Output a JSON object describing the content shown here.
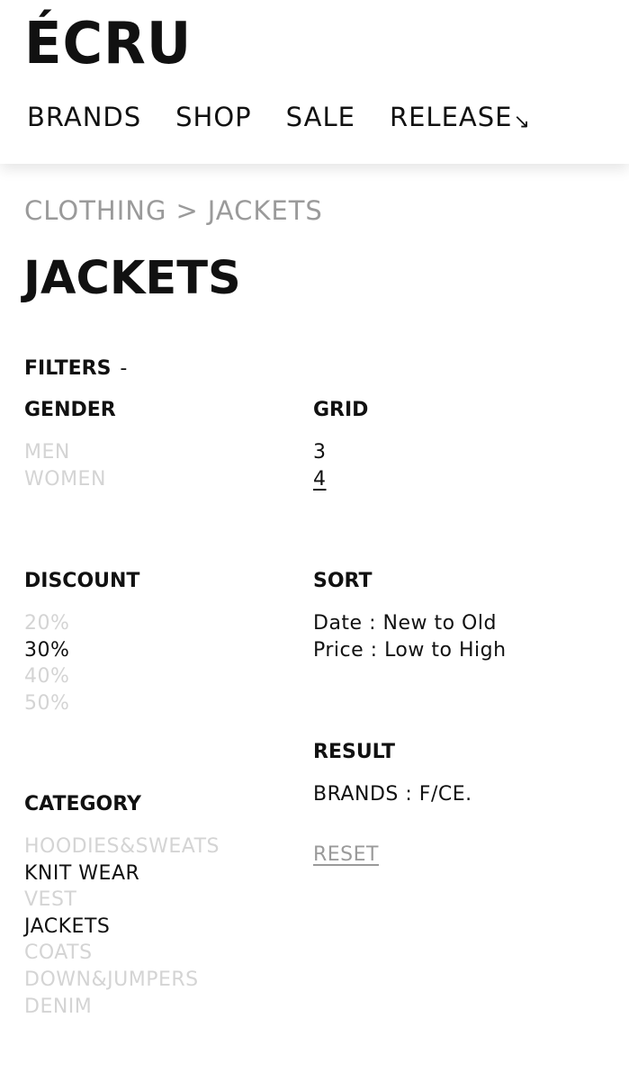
{
  "header": {
    "logo": "ÉCRU",
    "nav": [
      {
        "label": "BRANDS"
      },
      {
        "label": "SHOP"
      },
      {
        "label": "SALE"
      },
      {
        "label": "RELEASE",
        "icon": "↘"
      }
    ]
  },
  "breadcrumb": {
    "items": [
      "CLOTHING",
      "JACKETS"
    ],
    "separator": ">"
  },
  "page_title": "JACKETS",
  "filters": {
    "label": "FILTERS",
    "toggle": "-",
    "gender": {
      "heading": "GENDER",
      "options": [
        {
          "label": "MEN",
          "selected": false
        },
        {
          "label": "WOMEN",
          "selected": false
        }
      ]
    },
    "grid": {
      "heading": "GRID",
      "options": [
        {
          "label": "3",
          "selected": false
        },
        {
          "label": "4",
          "selected": true
        }
      ]
    },
    "discount": {
      "heading": "DISCOUNT",
      "options": [
        {
          "label": "20%",
          "selected": false
        },
        {
          "label": "30%",
          "selected": true
        },
        {
          "label": "40%",
          "selected": false
        },
        {
          "label": "50%",
          "selected": false
        }
      ]
    },
    "sort": {
      "heading": "SORT",
      "options": [
        {
          "label": "Date : New to Old"
        },
        {
          "label": "Price : Low to High"
        }
      ]
    },
    "result": {
      "heading": "RESULT",
      "text": "BRANDS : F/CE.",
      "reset": "RESET"
    },
    "category": {
      "heading": "CATEGORY",
      "options": [
        {
          "label": "HOODIES&SWEATS",
          "selected": false
        },
        {
          "label": "KNIT WEAR",
          "selected": true
        },
        {
          "label": "VEST",
          "selected": false
        },
        {
          "label": "JACKETS",
          "selected": true
        },
        {
          "label": "COATS",
          "selected": false
        },
        {
          "label": "DOWN&JUMPERS",
          "selected": false
        },
        {
          "label": "DENIM",
          "selected": false
        }
      ]
    }
  },
  "colors": {
    "text": "#111111",
    "muted": "#9a9a9a",
    "inactive": "#d4d4d4",
    "background": "#ffffff"
  }
}
